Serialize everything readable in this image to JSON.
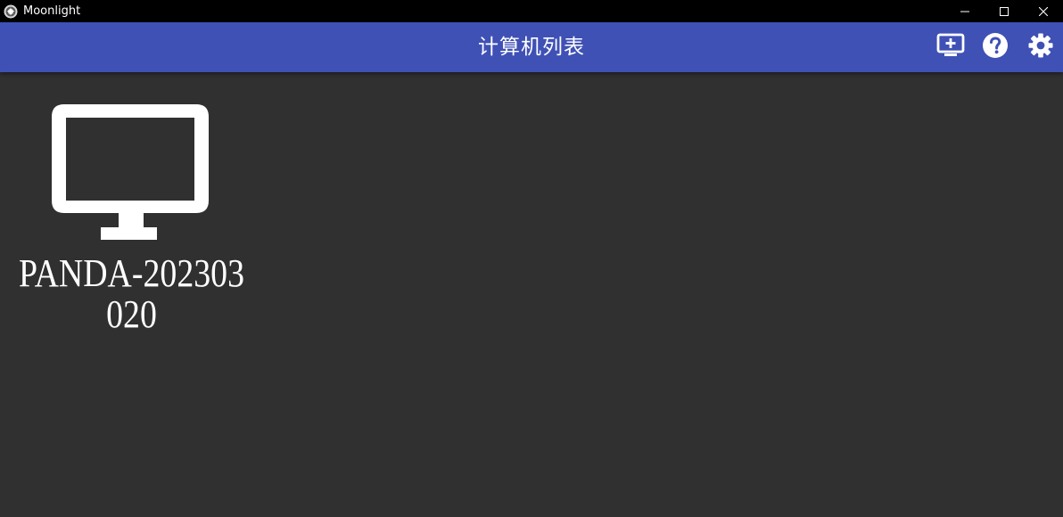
{
  "window": {
    "title": "Moonlight",
    "app_icon": "moonlight-logo-icon",
    "controls": [
      "minimize-icon",
      "maximize-icon",
      "close-icon"
    ]
  },
  "toolbar": {
    "title": "计算机列表",
    "background": "#3f51b5",
    "actions": [
      {
        "icon": "add-pc-icon"
      },
      {
        "icon": "help-icon"
      },
      {
        "icon": "settings-gear-icon"
      }
    ]
  },
  "content": {
    "background": "#303030",
    "computers": [
      {
        "name": "PANDA-202303020",
        "icon": "monitor-icon"
      }
    ]
  }
}
